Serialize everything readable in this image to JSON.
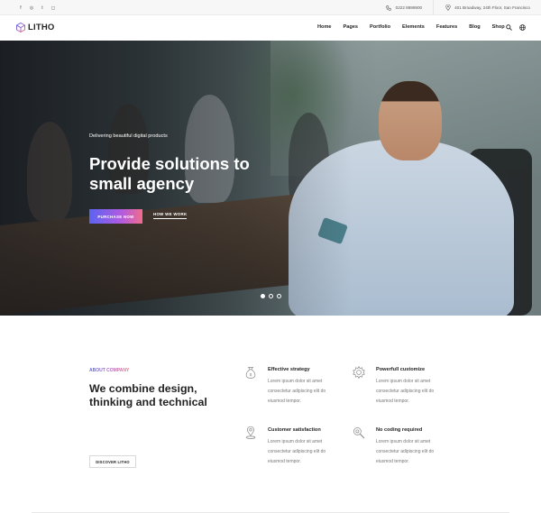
{
  "topbar": {
    "social": [
      {
        "icon": "facebook-icon",
        "glyph": "f"
      },
      {
        "icon": "dribbble-icon",
        "glyph": "◎"
      },
      {
        "icon": "twitter-icon",
        "glyph": "t"
      },
      {
        "icon": "instagram-icon",
        "glyph": "◻"
      }
    ],
    "phone": "0222 8899900",
    "address": "401 Broadway, 24th Floor, San Francisco"
  },
  "navbar": {
    "logo": "LITHO",
    "menu": [
      "Home",
      "Pages",
      "Portfolio",
      "Elements",
      "Features",
      "Blog",
      "Shop"
    ]
  },
  "hero": {
    "subtitle": "Delivering beautiful digital products",
    "title": "Provide solutions to small agency",
    "primary_button": "PURCHASE NOW",
    "secondary_link": "HOW WE WORK",
    "slides": 3,
    "active_slide": 1
  },
  "about": {
    "label": "ABOUT COMPANY",
    "heading": "We combine design, thinking and technical",
    "button": "DISCOVER LITHO",
    "features": [
      {
        "icon": "money-bag-icon",
        "title": "Effective strategy",
        "desc": "Lorem ipsum dolor sit amet consectetur adipiscing elit do eiusmod tempor."
      },
      {
        "icon": "gear-icon",
        "title": "Powerfull customize",
        "desc": "Lorem ipsum dolor sit amet consectetur adipiscing elit do eiusmod tempor."
      },
      {
        "icon": "location-pin-icon",
        "title": "Customer satisfaction",
        "desc": "Lorem ipsum dolor sit amet consectetur adipiscing elit do eiusmod tempor."
      },
      {
        "icon": "magnifier-gear-icon",
        "title": "No coding required",
        "desc": "Lorem ipsum dolor sit amet consectetur adipiscing elit do eiusmod tempor."
      }
    ]
  },
  "colors": {
    "gradient_start": "#5b63f2",
    "gradient_mid": "#b05be0",
    "gradient_end": "#f06c8c",
    "text_dark": "#232323",
    "text_muted": "#777777"
  }
}
